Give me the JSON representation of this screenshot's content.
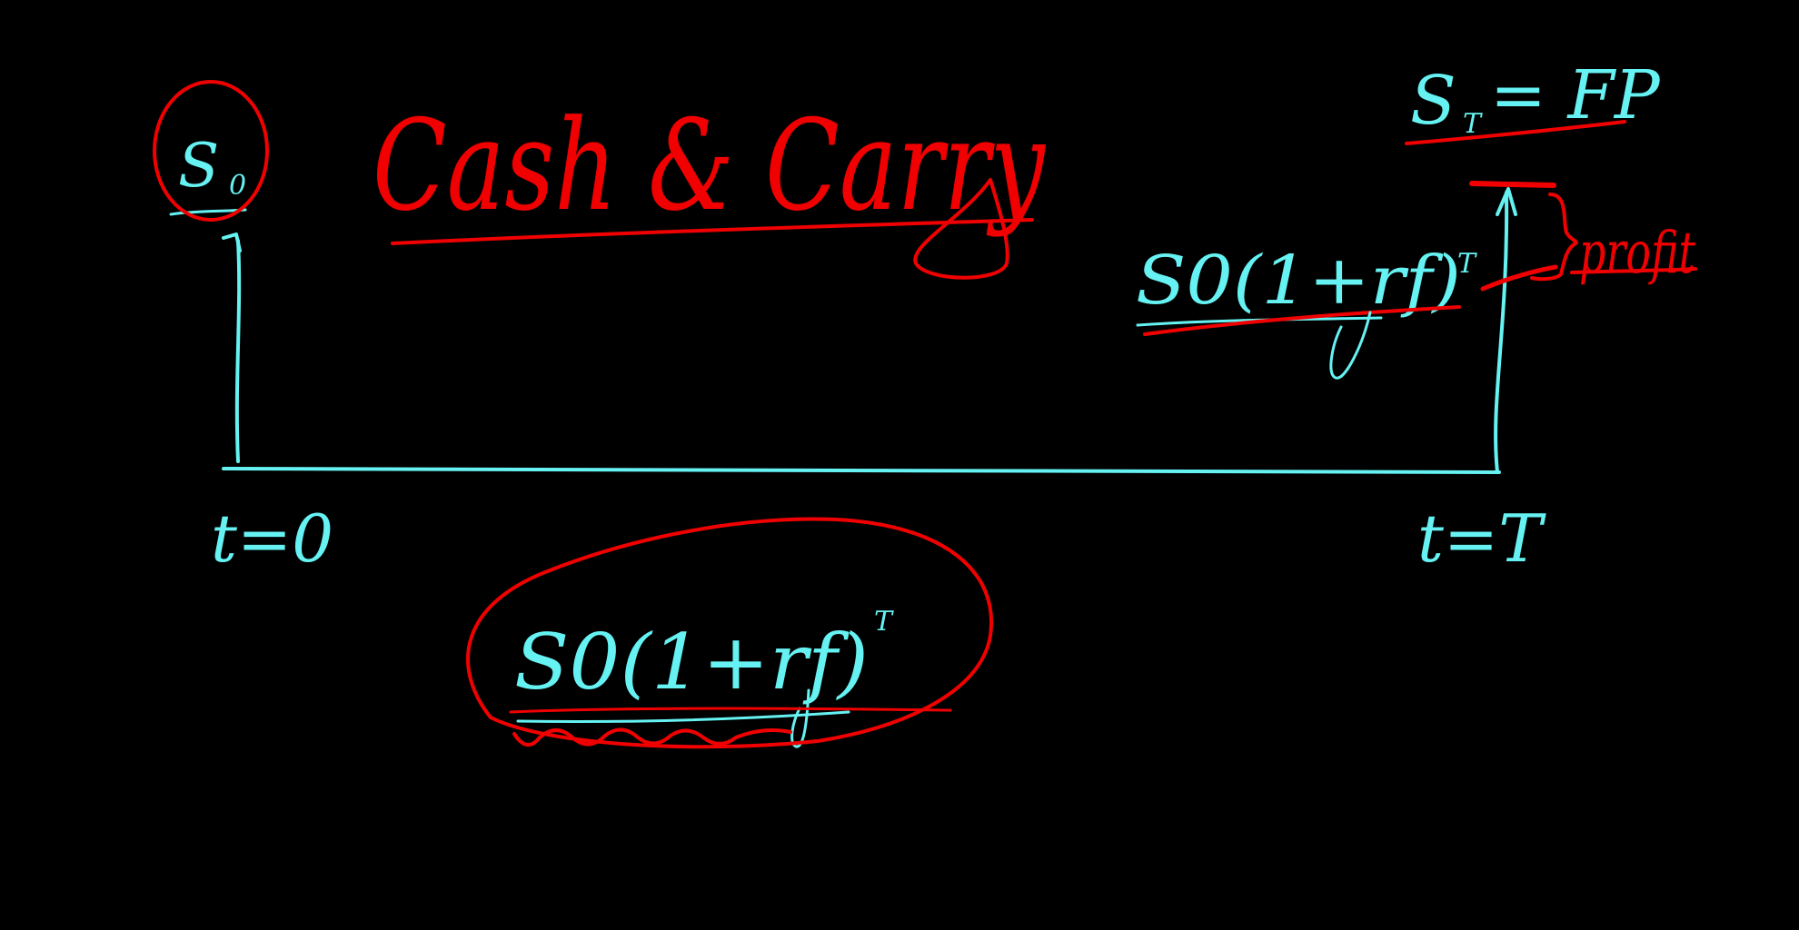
{
  "colors": {
    "background": "#000000",
    "cyan": "#66f2f2",
    "red": "#f00000"
  },
  "labels": {
    "title": "Cash & Carry",
    "spot_now": "S",
    "spot_now_sub": "0",
    "time_start": "t=0",
    "time_end": "t=T",
    "expiry_eq": "S",
    "expiry_eq_sub": "T",
    "expiry_eq_rest": "= FP",
    "compounded_upper": "S0(1+rf)",
    "compounded_upper_sup": "T",
    "profit": "profit",
    "compounded_lower": "S0(1+rf)",
    "compounded_lower_sup": "T"
  }
}
